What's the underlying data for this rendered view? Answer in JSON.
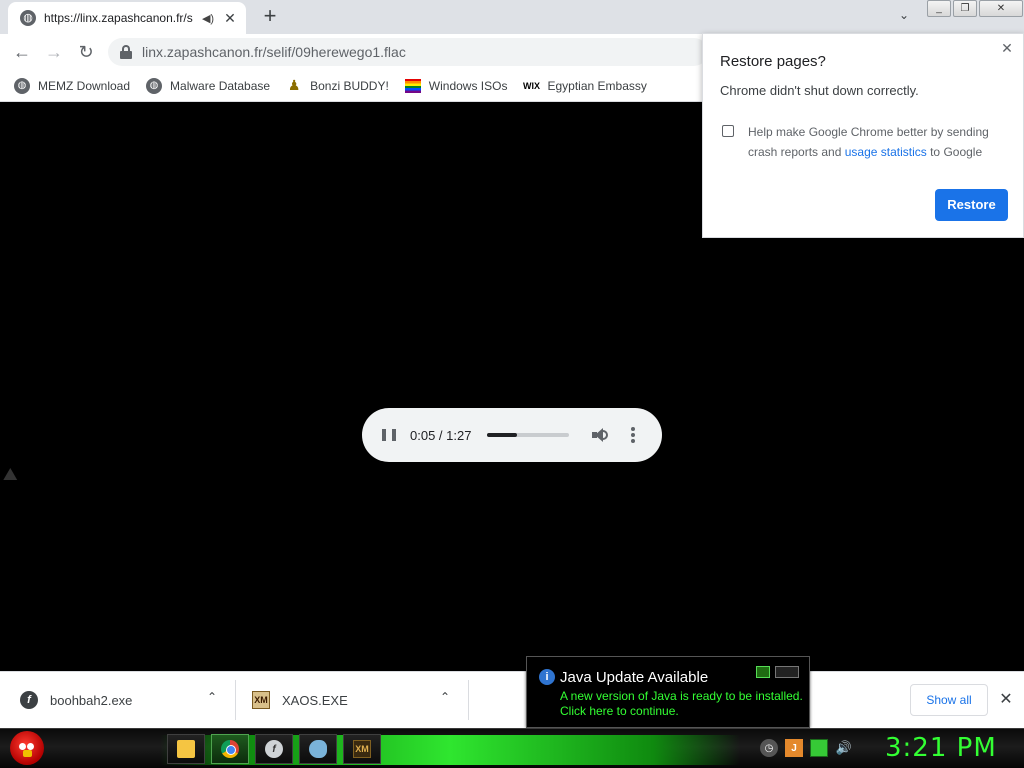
{
  "browser": {
    "tab": {
      "title": "https://linx.zapashcanon.fr/s",
      "audio_icon": "speaker-icon",
      "close_glyph": "✕"
    },
    "new_tab_glyph": "+",
    "tab_search_glyph": "⌄",
    "window_controls": [
      "_",
      "❐",
      "✕"
    ],
    "url": "linx.zapashcanon.fr/selif/09herewego1.flac",
    "nav": {
      "back": "←",
      "forward": "→",
      "reload": "↻"
    }
  },
  "bookmarks": [
    {
      "label": "MEMZ Download",
      "icon": "globe-icon"
    },
    {
      "label": "Malware Database",
      "icon": "globe-icon"
    },
    {
      "label": "Bonzi BUDDY!",
      "icon": "bonzi-icon"
    },
    {
      "label": "Windows ISOs",
      "icon": "rainbow-flag-icon"
    },
    {
      "label": "Egyptian Embassy",
      "icon": "wix-icon",
      "icon_text": "WIX"
    }
  ],
  "player": {
    "time": "0:05 / 1:27",
    "current_seconds": 5,
    "duration_seconds": 87
  },
  "restore_popup": {
    "title": "Restore pages?",
    "message": "Chrome didn't shut down correctly.",
    "report_text_before": "Help make Google Chrome better by sending crash reports and ",
    "report_link": "usage statistics",
    "report_text_after": " to Google",
    "checkbox_checked": false,
    "button_label": "Restore",
    "close_glyph": "✕",
    "accent_color": "#1a73e8"
  },
  "downloads": {
    "items": [
      {
        "name": "boohbah2.exe",
        "icon": "flash-icon",
        "icon_text": "f"
      },
      {
        "name": "XAOS.EXE",
        "icon": "xaos-icon",
        "icon_text": "XM"
      }
    ],
    "chevron_glyph": "⌃",
    "show_all_label": "Show all",
    "close_glyph": "✕"
  },
  "java_balloon": {
    "title": "Java Update Available",
    "body": "A new version of Java is ready to be installed. Click here to continue.",
    "info_glyph": "i",
    "text_color": "#33ff33"
  },
  "taskbar": {
    "clock": "3:21 PM",
    "clock_color": "#33ff33",
    "buttons": [
      {
        "name": "folder-icon",
        "icon_text": ""
      },
      {
        "name": "chrome-icon",
        "icon_text": ""
      },
      {
        "name": "flash-icon",
        "icon_text": "f"
      },
      {
        "name": "fish-icon",
        "icon_text": ""
      },
      {
        "name": "xaos-icon",
        "icon_text": "XM"
      }
    ],
    "tray": [
      "clock-tray-icon",
      "java-tray-icon",
      "network-icon",
      "volume-icon"
    ],
    "tray_glyphs": {
      "clock": "◷",
      "java": "J",
      "volume": "🔊"
    }
  }
}
